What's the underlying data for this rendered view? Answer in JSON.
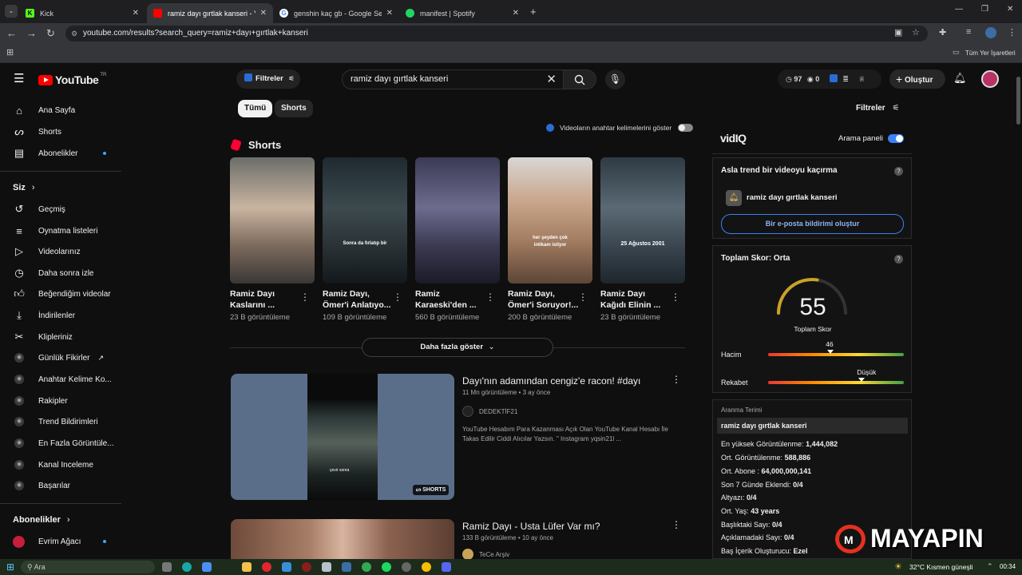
{
  "browser": {
    "tabs": [
      {
        "label": "Kick",
        "active": false,
        "icon": "kick-icon",
        "color": "#53fc18"
      },
      {
        "label": "ramiz dayı gırtlak kanseri - YouTube",
        "active": true,
        "icon": "youtube-icon",
        "color": "#ff0000"
      },
      {
        "label": "genshin kaç gb - Google Search",
        "active": false,
        "icon": "google-icon",
        "color": "#4285f4"
      },
      {
        "label": "manifest | Spotify",
        "active": false,
        "icon": "spotify-icon",
        "color": "#1ed760"
      }
    ],
    "url": "youtube.com/results?search_query=ramiz+dayı+gırtlak+kanseri",
    "bookmarks_label": "Tüm Yer İşaretleri"
  },
  "youtube": {
    "logo": "YouTube",
    "logo_region": "TR",
    "filters_btn": "Filtreler",
    "search_value": "ramiz dayı gırtlak kanseri",
    "vidiq_count_a": "97",
    "vidiq_count_b": "0",
    "create_btn": "Oluştur",
    "filters_right": "Filtreler",
    "chips": [
      "Tümü",
      "Shorts"
    ],
    "keyword_toggle_label": "Videoların anahtar kelimelerini göster",
    "shorts_heading": "Shorts",
    "shorts": [
      {
        "title": "Ramiz Dayı Kaslarını ...",
        "views": "23 B görüntüleme",
        "overlay": ""
      },
      {
        "title": "Ramiz Dayı, Ömer'i Anlatıyo...",
        "views": "109 B görüntüleme",
        "overlay": "Sonra da fırlatıp bir"
      },
      {
        "title": "Ramiz Karaeski'den ...",
        "views": "560 B görüntüleme",
        "overlay": ""
      },
      {
        "title": "Ramiz Dayı, Ömer'i Soruyor!...",
        "views": "200 B görüntüleme",
        "overlay": "her şeyden çok intikam istiyor"
      },
      {
        "title": "Ramiz Dayı Kağıdı Elinin ...",
        "views": "23 B görüntüleme",
        "overlay": "25 Ağustos 2001"
      }
    ],
    "more_btn": "Daha fazla göster",
    "videos": [
      {
        "title": "Dayı'nın adamından cengiz'e racon! #dayı",
        "meta": "11 Mn görüntüleme • 3 ay önce",
        "channel": "DEDEKTİF21",
        "desc": "YouTube Hesabım Para Kazanması Açık Olan YouTube Kanal Hesabı İle Takas Edilir Ciddi Alıcılar Yazsın. \" Instagram yqsin21l ...",
        "badge": "SHORTS",
        "thumb_text": "çevir sonra"
      },
      {
        "title": "Ramiz Dayı - Usta Lüfer Var mı?",
        "meta": "133 B görüntüleme • 10 ay önce",
        "channel": "TeCe Arşiv"
      }
    ]
  },
  "sidebar": {
    "main": [
      {
        "label": "Ana Sayfa",
        "icon": "home-icon"
      },
      {
        "label": "Shorts",
        "icon": "shorts-icon"
      },
      {
        "label": "Abonelikler",
        "icon": "subscriptions-icon"
      }
    ],
    "you_heading": "Siz",
    "you_items": [
      {
        "label": "Geçmiş",
        "icon": "history-icon"
      },
      {
        "label": "Oynatma listeleri",
        "icon": "playlist-icon"
      },
      {
        "label": "Videolarınız",
        "icon": "your-videos-icon"
      },
      {
        "label": "Daha sonra izle",
        "icon": "watch-later-icon"
      },
      {
        "label": "Beğendiğim videolar",
        "icon": "like-icon"
      },
      {
        "label": "İndirilenler",
        "icon": "download-icon"
      },
      {
        "label": "Klipleriniz",
        "icon": "clips-icon"
      }
    ],
    "vidiq_items": [
      {
        "label": "Günlük Fikirler"
      },
      {
        "label": "Anahtar Kelime Ko..."
      },
      {
        "label": "Rakipler"
      },
      {
        "label": "Trend Bildirimleri"
      },
      {
        "label": "En Fazla Görüntüle..."
      },
      {
        "label": "Kanal Inceleme"
      },
      {
        "label": "Başarılar"
      }
    ],
    "subs_heading": "Abonelikler",
    "subs": [
      {
        "label": "Evrim Ağacı"
      }
    ]
  },
  "vidiq": {
    "logo": "vidIQ",
    "search_panel_label": "Arama paneli",
    "trend_title": "Asla trend bir videoyu kaçırma",
    "trend_keyword": "ramiz dayı gırtlak kanseri",
    "email_btn": "Bir e-posta bildirimi oluştur",
    "score_title": "Toplam Skor: Orta",
    "score_value": "55",
    "score_fraction": 0.55,
    "score_label": "Toplam Skor",
    "volume_label": "Hacim",
    "volume_value": "46",
    "volume_fraction": 0.46,
    "competition_label": "Rekabet",
    "competition_value": "Düşük",
    "competition_fraction": 0.69,
    "search_term_label": "Aranma Terimi",
    "search_term": "ramiz dayı gırtlak kanseri",
    "stats": [
      {
        "label": "En yüksek Görüntülenme:",
        "value": "1,444,082"
      },
      {
        "label": "Ort. Görüntülenme:",
        "value": "588,886"
      },
      {
        "label": "Ort. Abone :",
        "value": "64,000,000,141"
      },
      {
        "label": "Son 7 Günde Eklendi:",
        "value": "0/4"
      },
      {
        "label": "Altyazı:",
        "value": "0/4"
      },
      {
        "label": "Ort. Yaş:",
        "value": "43 years"
      },
      {
        "label": "Başlıktaki Sayı:",
        "value": "0/4"
      },
      {
        "label": "Açıklamadaki Sayı:",
        "value": "0/4"
      },
      {
        "label": "Baş İçerik Oluşturucu:",
        "value": "Ezel"
      }
    ]
  },
  "watermark": "MAYAPIN",
  "taskbar": {
    "search_placeholder": "Ara",
    "weather": "32°C  Kısmen güneşli",
    "time": "00:34"
  }
}
